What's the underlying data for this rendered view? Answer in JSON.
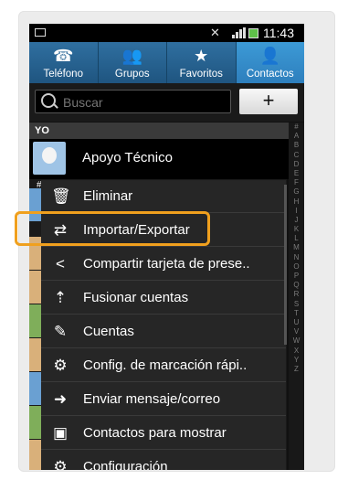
{
  "status_bar": {
    "time": "11:43"
  },
  "tabs": [
    {
      "label": "Teléfono",
      "icon": "phone-icon",
      "active": false
    },
    {
      "label": "Grupos",
      "icon": "groups-icon",
      "active": false
    },
    {
      "label": "Favoritos",
      "icon": "star-icon",
      "active": false
    },
    {
      "label": "Contactos",
      "icon": "person-icon",
      "active": true
    }
  ],
  "search": {
    "placeholder": "Buscar",
    "add_label": "+"
  },
  "section_header": "YO",
  "profile": {
    "name": "Apoyo Técnico"
  },
  "section_hash": "#",
  "menu": [
    {
      "label": "Eliminar",
      "icon": "trash-icon",
      "glyph": "🗑"
    },
    {
      "label": "Importar/Exportar",
      "icon": "import-export-icon",
      "glyph": "⇄"
    },
    {
      "label": "Compartir tarjeta de prese..",
      "icon": "share-icon",
      "glyph": "<"
    },
    {
      "label": "Fusionar cuentas",
      "icon": "merge-icon",
      "glyph": "⇡"
    },
    {
      "label": "Cuentas",
      "icon": "key-icon",
      "glyph": "✎"
    },
    {
      "label": "Config. de marcación rápi..",
      "icon": "speed-dial-icon",
      "glyph": "⚙"
    },
    {
      "label": "Enviar mensaje/correo",
      "icon": "arrow-right-icon",
      "glyph": "➜"
    },
    {
      "label": "Contactos para mostrar",
      "icon": "contact-card-icon",
      "glyph": "▣"
    },
    {
      "label": "Configuración",
      "icon": "settings-icon",
      "glyph": "⚙"
    }
  ],
  "alpha_index": [
    "#",
    "A",
    "B",
    "C",
    "D",
    "E",
    "F",
    "G",
    "H",
    "I",
    "J",
    "K",
    "L",
    "M",
    "N",
    "O",
    "P",
    "Q",
    "R",
    "S",
    "T",
    "U",
    "V",
    "W",
    "X",
    "Y",
    "Z"
  ],
  "colors": {
    "highlight": "#f0a01e",
    "tab_active": "#2e7fbd"
  }
}
